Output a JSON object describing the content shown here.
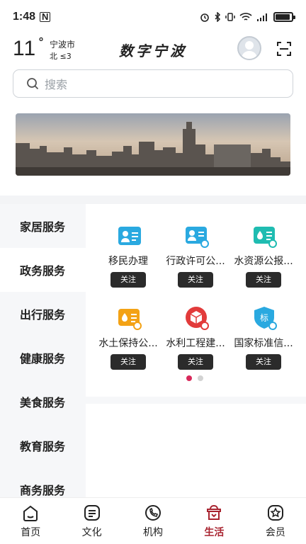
{
  "status_bar": {
    "time": "1:48",
    "nfc": "N"
  },
  "weather": {
    "temperature": "11",
    "unit": "°",
    "city": "宁波市",
    "wind": "北 ≤3"
  },
  "header": {
    "app_title": "数字宁波"
  },
  "search": {
    "placeholder": "搜索"
  },
  "categories": [
    {
      "label": "家居服务"
    },
    {
      "label": "政务服务"
    },
    {
      "label": "出行服务"
    },
    {
      "label": "健康服务"
    },
    {
      "label": "美食服务"
    },
    {
      "label": "教育服务"
    },
    {
      "label": "商务服务"
    }
  ],
  "services": [
    {
      "label": "移民办理",
      "follow": "关注",
      "color": "#2aa9e0"
    },
    {
      "label": "行政许可公...",
      "follow": "关注",
      "color": "#2aa9e0"
    },
    {
      "label": "水资源公报...",
      "follow": "关注",
      "color": "#1fbcb1"
    },
    {
      "label": "水土保持公...",
      "follow": "关注",
      "color": "#f3a215"
    },
    {
      "label": "水利工程建...",
      "follow": "关注",
      "color": "#e23b3b"
    },
    {
      "label": "国家标准信...",
      "follow": "关注",
      "color": "#2aa9e0"
    }
  ],
  "nav": [
    {
      "label": "首页",
      "icon": "home-icon"
    },
    {
      "label": "文化",
      "icon": "culture-icon"
    },
    {
      "label": "机构",
      "icon": "organization-icon"
    },
    {
      "label": "生活",
      "icon": "life-icon"
    },
    {
      "label": "会员",
      "icon": "member-icon"
    }
  ],
  "colors": {
    "active_nav": "#a8232f",
    "active_dot": "#d8295a",
    "follow_button": "#2b2b2b"
  },
  "pager": {
    "current": 1,
    "total": 2
  },
  "active_category": 1,
  "active_nav": 3
}
